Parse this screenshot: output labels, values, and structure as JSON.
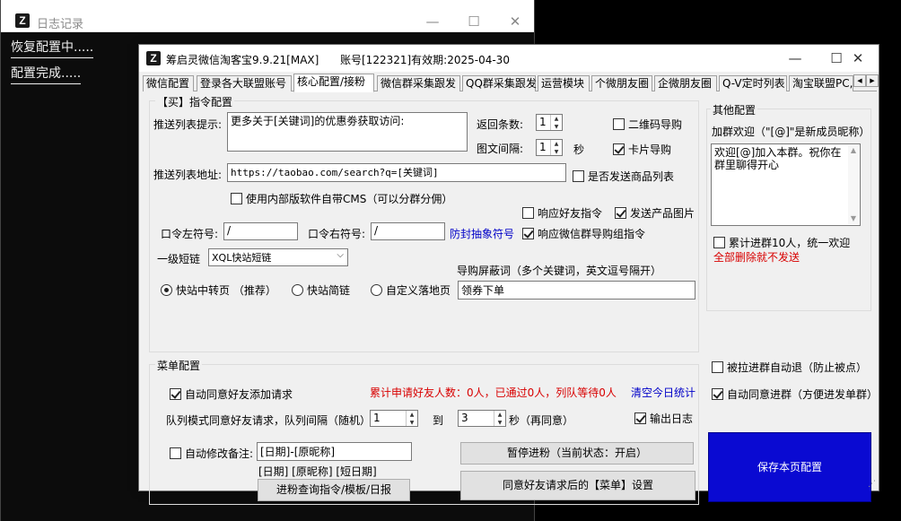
{
  "log_window": {
    "title": "日志记录",
    "lines": [
      "恢复配置中.....",
      "配置完成....."
    ]
  },
  "main_window": {
    "title": "筹启灵微信淘客宝9.9.21[MAX]",
    "account_info": "账号[122321]有效期:2025-04-30"
  },
  "tabs": [
    "微信配置",
    "登录各大联盟账号",
    "核心配置/接粉",
    "微信群采集跟发",
    "QQ群采集跟发",
    "运营模块",
    "个微朋友圈",
    "企微朋友圈",
    "Q-V定时列表",
    "淘宝联盟PC,"
  ],
  "buy_group": {
    "legend": "【买】指令配置",
    "push_tip_label": "推送列表提示:",
    "push_tip_value": "更多关于[关键词]的优惠劵获取访问:",
    "return_count_label": "返回条数:",
    "return_count_value": "1",
    "interval_label": "图文间隔:",
    "interval_value": "1",
    "seconds": "秒",
    "qrcode_label": "二维码导购",
    "card_label": "卡片导购",
    "push_url_label": "推送列表地址:",
    "push_url_value": "https://taobao.com/search?q=[关键词]",
    "send_goods_list": "是否发送商品列表",
    "use_cms": "使用内部版软件自带CMS（可以分群分佣）",
    "respond_friend": "响应好友指令",
    "send_images": "发送产品图片",
    "respond_group": "响应微信群导购组指令",
    "left_symbol_label": "口令左符号:",
    "left_symbol_value": "/",
    "right_symbol_label": "口令右符号:",
    "right_symbol_value": "/",
    "anti_block": "防封抽象符号",
    "short_link_label": "一级短链",
    "short_link_value": "XQL快站短链",
    "shield_label": "导购屏蔽词（多个关键词，英文逗号隔开）",
    "shield_value": "领券下单",
    "radio_options": [
      "快站中转页 （推荐）",
      "快站简链",
      "自定义落地页"
    ]
  },
  "other_group": {
    "legend": "其他配置",
    "welcome_label": "加群欢迎（\"[@]\"是新成员昵称）",
    "welcome_value": "欢迎[@]加入本群。祝你在群里聊得开心",
    "accumulate_label": "累计进群10人，统一欢迎",
    "delete_warning": "全部删除就不发送"
  },
  "menu_group": {
    "legend": "菜单配置",
    "auto_accept": "自动同意好友添加请求",
    "stats": "累计申请好友人数：0人，已通过0人，列队等待0人",
    "clear_stats": "清空今日统计",
    "queue_label": "队列模式同意好友请求，队列间隔（随机）",
    "queue_from": "1",
    "to_label": "到",
    "queue_to": "3",
    "seconds_label": "秒（再同意）",
    "output_log": "输出日志",
    "auto_remark": "自动修改备注:",
    "remark_value": "[日期]-[原昵称]",
    "remark_vars": "[日期] [原昵称] [短日期]",
    "pause_button": "暂停进粉（当前状态：开启）",
    "query_button": "进粉查询指令/模板/日报",
    "menu_button": "同意好友请求后的【菜单】设置"
  },
  "right_side": {
    "kicked_exit": "被拉进群自动退（防止被点）",
    "auto_join": "自动同意进群（方便进发单群）",
    "save_button": "保存本页配置"
  },
  "colors": {
    "save_button_bg": "#0a0ad2",
    "warning_text": "#d80000",
    "link_text": "#0000c8"
  }
}
